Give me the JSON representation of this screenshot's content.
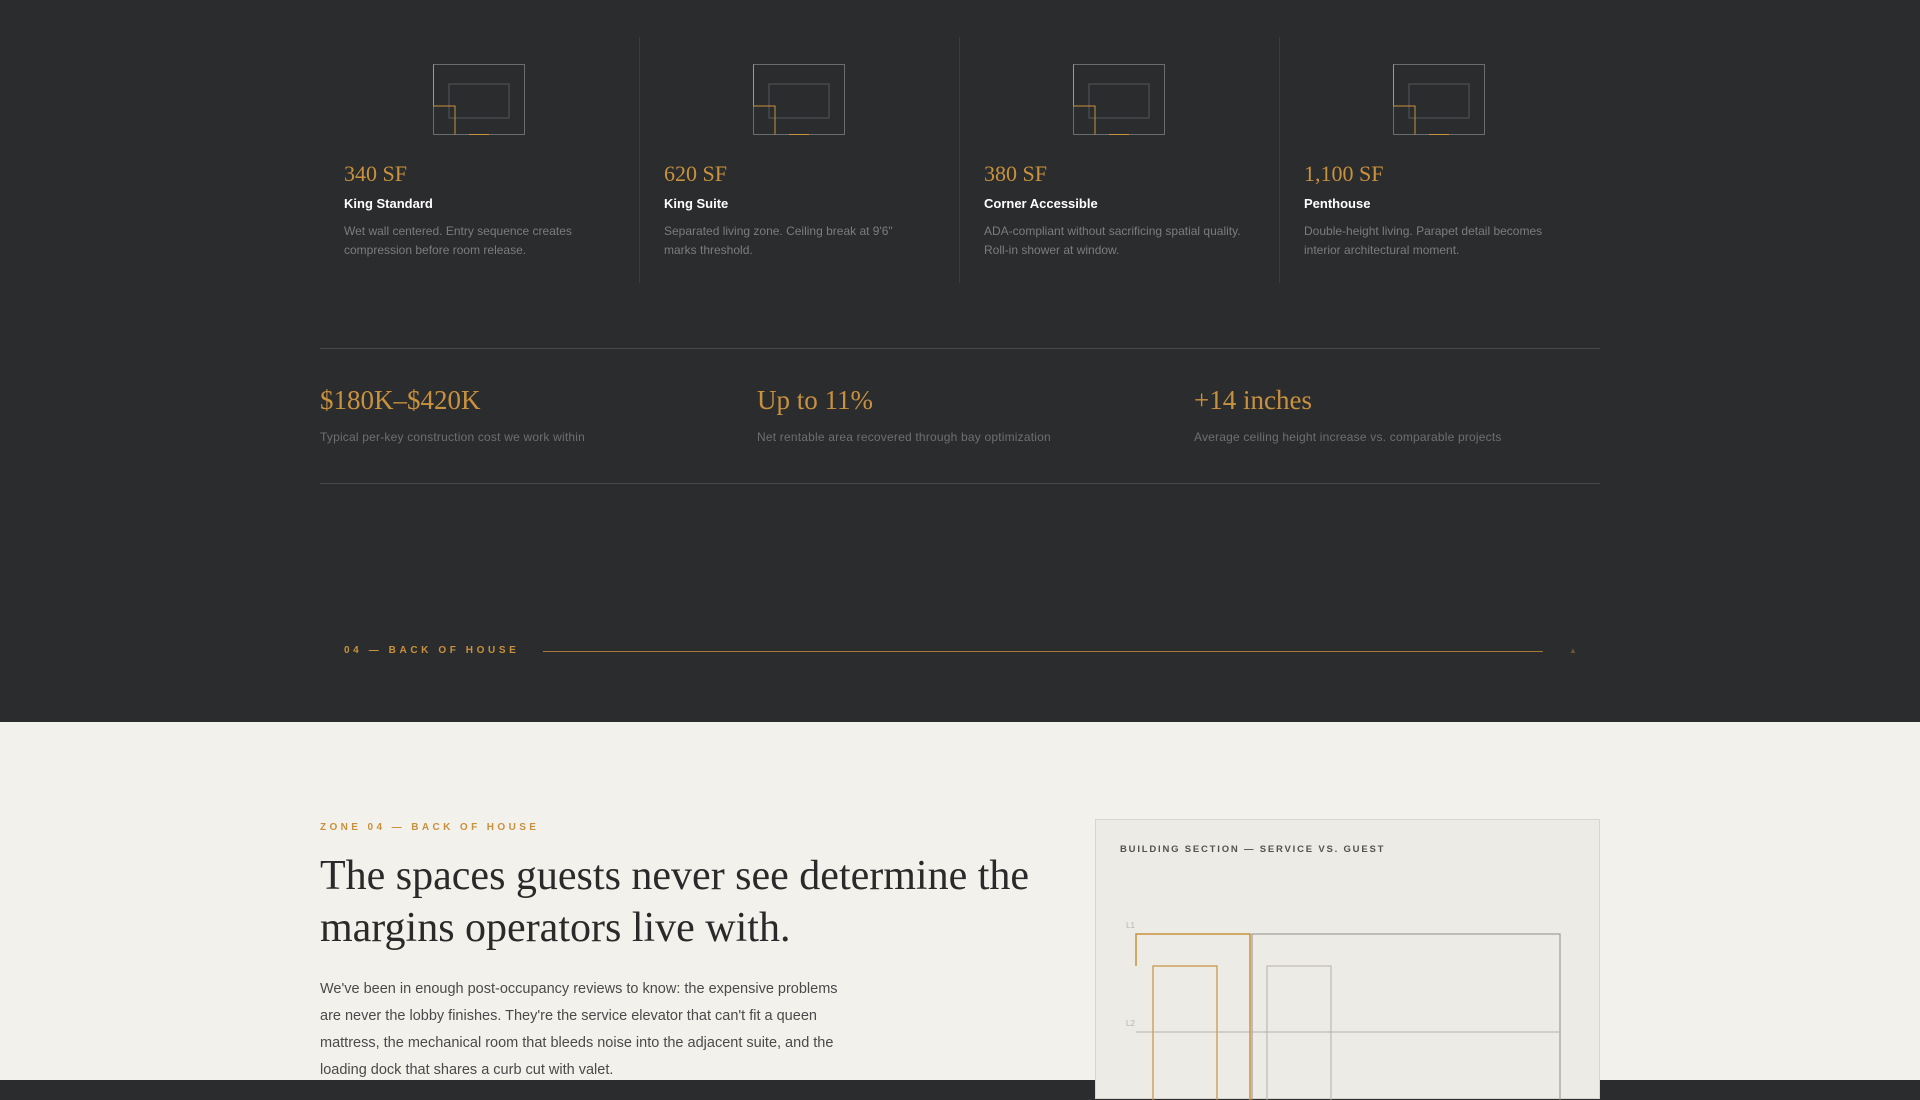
{
  "rooms": [
    {
      "sf": "340 SF",
      "name": "King Standard",
      "desc": "Wet wall centered. Entry sequence creates compression before room release."
    },
    {
      "sf": "620 SF",
      "name": "King Suite",
      "desc": "Separated living zone. Ceiling break at 9'6\" marks threshold."
    },
    {
      "sf": "380 SF",
      "name": "Corner Accessible",
      "desc": "ADA-compliant without sacrificing spatial quality. Roll-in shower at window."
    },
    {
      "sf": "1,100 SF",
      "name": "Penthouse",
      "desc": "Double-height living. Parapet detail becomes interior architectural moment."
    }
  ],
  "stats": [
    {
      "value": "$180K–$420K",
      "caption": "Typical per-key construction cost we work within"
    },
    {
      "value": "Up to 11%",
      "caption": "Net rentable area recovered through bay optimization"
    },
    {
      "value": "+14 inches",
      "caption": "Average ceiling height increase vs. comparable projects"
    }
  ],
  "section_marker": {
    "label": "04 — BACK OF HOUSE",
    "glyph": "▲"
  },
  "back_of_house": {
    "zone_label": "ZONE 04 — BACK OF HOUSE",
    "headline": "The spaces guests never see determine the margins operators live with.",
    "body": "We've been in enough post-occupancy reviews to know: the expensive problems are never the lobby finishes. They're the service elevator that can't fit a queen mattress, the mechanical room that bleeds noise into the adjacent suite, and the loading dock that shares a curb cut with valet."
  },
  "diagram": {
    "title": "BUILDING SECTION — SERVICE VS. GUEST",
    "level_labels": [
      "L1",
      "L2"
    ]
  },
  "colors": {
    "accent": "#c8913e",
    "dark_bg": "#2b2c2e",
    "light_bg": "#f3f1ec"
  }
}
